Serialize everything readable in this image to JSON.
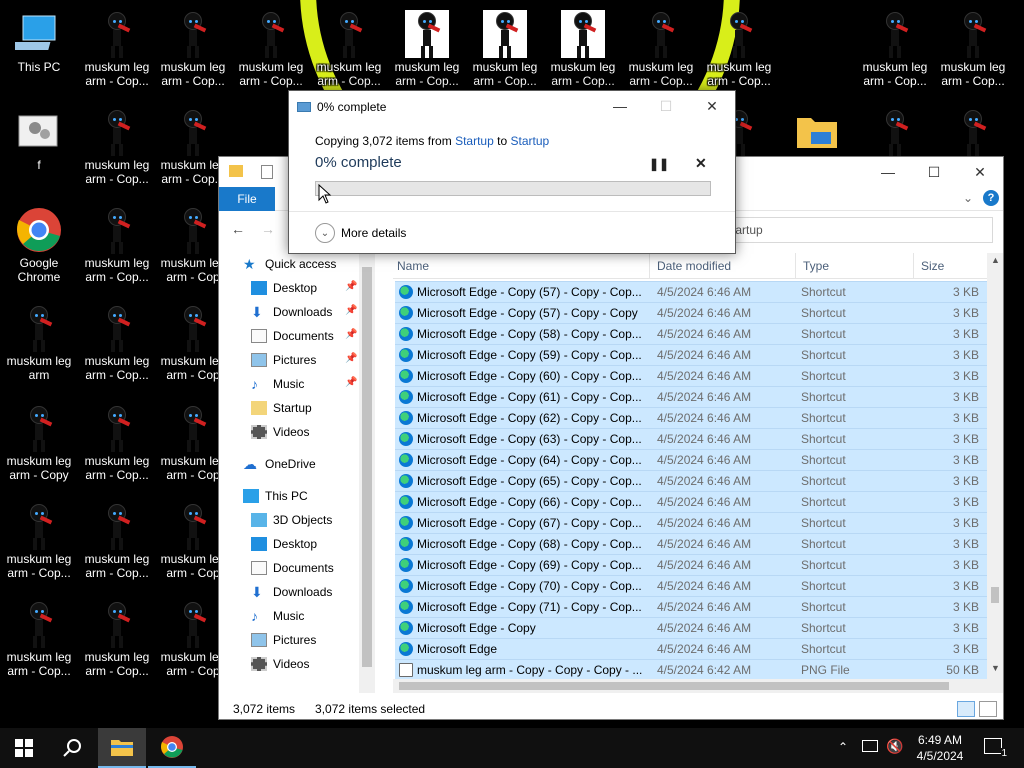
{
  "desktop": {
    "icons": {
      "this_pc": "This PC",
      "f": "f",
      "chrome_line1": "Google",
      "chrome_line2": "Chrome",
      "muskum_l1": "muskum leg",
      "muskum_copy": "arm - Copy",
      "muskum_cop": "arm - Cop...",
      "muskum_arm": "arm",
      "muskum_trunc": "arm - Cop"
    }
  },
  "progress_dialog": {
    "title": "0% complete",
    "copying_prefix": "Copying 3,072 items from",
    "source": "Startup",
    "to_word": "to",
    "destination": "Startup",
    "percent_label": "0% complete",
    "progress": 0,
    "more_details": "More details"
  },
  "explorer": {
    "file_tab": "File",
    "address": "tartup",
    "nav": {
      "quick_access": "Quick access",
      "desktop": "Desktop",
      "downloads": "Downloads",
      "documents": "Documents",
      "pictures": "Pictures",
      "music": "Music",
      "startup": "Startup",
      "videos": "Videos",
      "onedrive": "OneDrive",
      "this_pc": "This PC",
      "objects3d": "3D Objects",
      "pc_desktop": "Desktop",
      "pc_documents": "Documents",
      "pc_downloads": "Downloads",
      "pc_music": "Music",
      "pc_pictures": "Pictures",
      "pc_videos": "Videos"
    },
    "columns": {
      "name": "Name",
      "date": "Date modified",
      "type": "Type",
      "size": "Size"
    },
    "rows": [
      {
        "name": "Microsoft Edge - Copy (57) - Copy - Cop...",
        "date": "4/5/2024 6:46 AM",
        "type": "Shortcut",
        "size": "3 KB"
      },
      {
        "name": "Microsoft Edge - Copy (57) - Copy - Copy",
        "date": "4/5/2024 6:46 AM",
        "type": "Shortcut",
        "size": "3 KB"
      },
      {
        "name": "Microsoft Edge - Copy (58) - Copy - Cop...",
        "date": "4/5/2024 6:46 AM",
        "type": "Shortcut",
        "size": "3 KB"
      },
      {
        "name": "Microsoft Edge - Copy (59) - Copy - Cop...",
        "date": "4/5/2024 6:46 AM",
        "type": "Shortcut",
        "size": "3 KB"
      },
      {
        "name": "Microsoft Edge - Copy (60) - Copy - Cop...",
        "date": "4/5/2024 6:46 AM",
        "type": "Shortcut",
        "size": "3 KB"
      },
      {
        "name": "Microsoft Edge - Copy (61) - Copy - Cop...",
        "date": "4/5/2024 6:46 AM",
        "type": "Shortcut",
        "size": "3 KB"
      },
      {
        "name": "Microsoft Edge - Copy (62) - Copy - Cop...",
        "date": "4/5/2024 6:46 AM",
        "type": "Shortcut",
        "size": "3 KB"
      },
      {
        "name": "Microsoft Edge - Copy (63) - Copy - Cop...",
        "date": "4/5/2024 6:46 AM",
        "type": "Shortcut",
        "size": "3 KB"
      },
      {
        "name": "Microsoft Edge - Copy (64) - Copy - Cop...",
        "date": "4/5/2024 6:46 AM",
        "type": "Shortcut",
        "size": "3 KB"
      },
      {
        "name": "Microsoft Edge - Copy (65) - Copy - Cop...",
        "date": "4/5/2024 6:46 AM",
        "type": "Shortcut",
        "size": "3 KB"
      },
      {
        "name": "Microsoft Edge - Copy (66) - Copy - Cop...",
        "date": "4/5/2024 6:46 AM",
        "type": "Shortcut",
        "size": "3 KB"
      },
      {
        "name": "Microsoft Edge - Copy (67) - Copy - Cop...",
        "date": "4/5/2024 6:46 AM",
        "type": "Shortcut",
        "size": "3 KB"
      },
      {
        "name": "Microsoft Edge - Copy (68) - Copy - Cop...",
        "date": "4/5/2024 6:46 AM",
        "type": "Shortcut",
        "size": "3 KB"
      },
      {
        "name": "Microsoft Edge - Copy (69) - Copy - Cop...",
        "date": "4/5/2024 6:46 AM",
        "type": "Shortcut",
        "size": "3 KB"
      },
      {
        "name": "Microsoft Edge - Copy (70) - Copy - Cop...",
        "date": "4/5/2024 6:46 AM",
        "type": "Shortcut",
        "size": "3 KB"
      },
      {
        "name": "Microsoft Edge - Copy (71) - Copy - Cop...",
        "date": "4/5/2024 6:46 AM",
        "type": "Shortcut",
        "size": "3 KB"
      },
      {
        "name": "Microsoft Edge - Copy",
        "date": "4/5/2024 6:46 AM",
        "type": "Shortcut",
        "size": "3 KB"
      },
      {
        "name": "Microsoft Edge",
        "date": "4/5/2024 6:46 AM",
        "type": "Shortcut",
        "size": "3 KB"
      },
      {
        "name": "muskum leg arm - Copy - Copy - Copy - ...",
        "date": "4/5/2024 6:42 AM",
        "type": "PNG File",
        "size": "50 KB"
      }
    ],
    "status": {
      "count": "3,072 items",
      "selected": "3,072 items selected"
    }
  },
  "taskbar": {
    "time": "6:49 AM",
    "date": "4/5/2024",
    "notification_count": "1"
  },
  "colors": {
    "accent": "#1979ca",
    "selection": "#cce8ff",
    "halo": "#d8ee1a"
  }
}
